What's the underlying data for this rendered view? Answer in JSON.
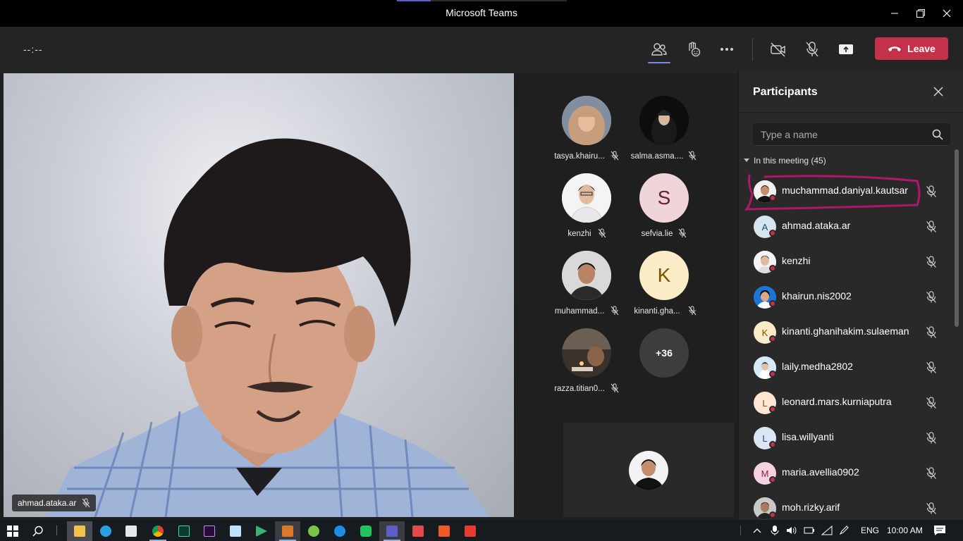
{
  "window": {
    "title": "Microsoft Teams"
  },
  "toolbar": {
    "timer": "--:--",
    "leave_label": "Leave"
  },
  "main_video": {
    "participant_name": "ahmad.ataka.ar"
  },
  "gallery": {
    "tiles": [
      {
        "name": "tasya.khairu...",
        "initial": ""
      },
      {
        "name": "salma.asma....",
        "initial": ""
      },
      {
        "name": "kenzhi",
        "initial": ""
      },
      {
        "name": "sefvia.lie",
        "initial": "S"
      },
      {
        "name": "muhammad...",
        "initial": ""
      },
      {
        "name": "kinanti.gha...",
        "initial": "K"
      },
      {
        "name": "razza.titian0...",
        "initial": ""
      }
    ],
    "overflow_count": "+36"
  },
  "panel": {
    "title": "Participants",
    "search_placeholder": "Type a name",
    "section_label": "In this meeting (45)",
    "participants": [
      {
        "name": "muchammad.daniyal.kautsar",
        "initial": ""
      },
      {
        "name": "ahmad.ataka.ar",
        "initial": "A"
      },
      {
        "name": "kenzhi",
        "initial": ""
      },
      {
        "name": "khairun.nis2002",
        "initial": ""
      },
      {
        "name": "kinanti.ghanihakim.sulaeman",
        "initial": "K"
      },
      {
        "name": "laily.medha2802",
        "initial": ""
      },
      {
        "name": "leonard.mars.kurniaputra",
        "initial": "L"
      },
      {
        "name": "lisa.willyanti",
        "initial": "L"
      },
      {
        "name": "maria.avellia0902",
        "initial": "M"
      },
      {
        "name": "moh.rizky.arif",
        "initial": ""
      }
    ]
  },
  "taskbar": {
    "language": "ENG",
    "clock": "10:00 AM"
  },
  "colors": {
    "leave": "#c4314b",
    "accent": "#7f85f5",
    "highlight_annotation": "#b0176b"
  }
}
